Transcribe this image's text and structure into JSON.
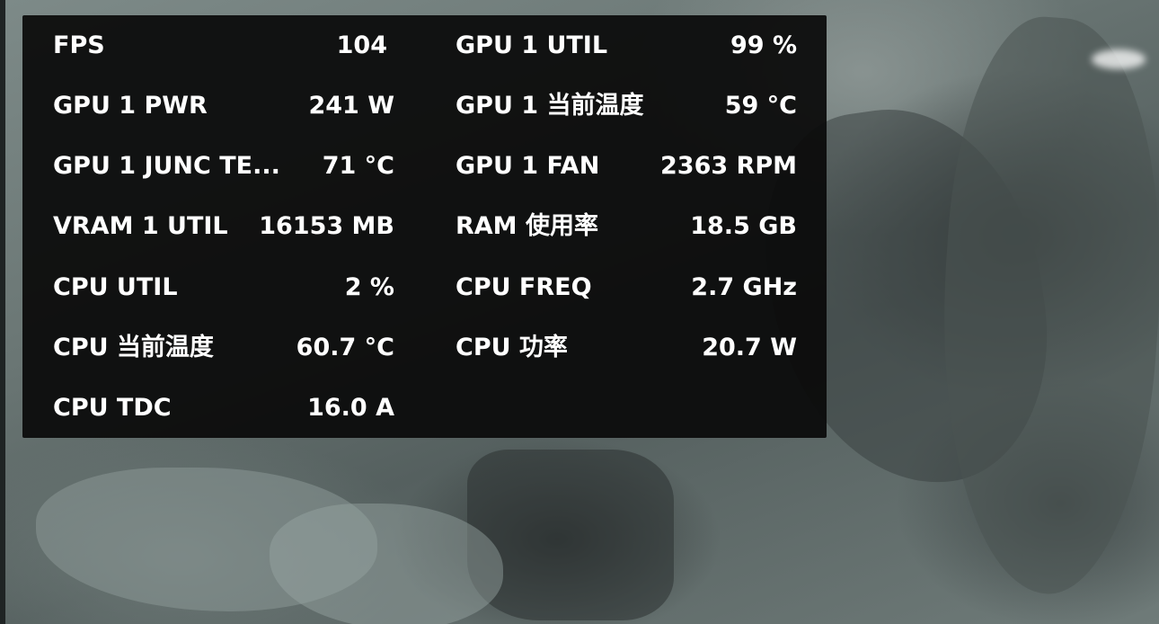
{
  "overlay": {
    "left_column": [
      {
        "label": "FPS",
        "value": "104"
      },
      {
        "label": "GPU 1 PWR",
        "value": "241 W"
      },
      {
        "label": "GPU 1 JUNC TE...",
        "value": "71 °C"
      },
      {
        "label": "VRAM 1 UTIL",
        "value": "16153 MB"
      },
      {
        "label": "CPU UTIL",
        "value": "2 %"
      },
      {
        "label": "CPU 当前温度",
        "value": "60.7 °C"
      },
      {
        "label": "CPU TDC",
        "value": "16.0 A"
      }
    ],
    "right_column": [
      {
        "label": "GPU 1 UTIL",
        "value": "99 %"
      },
      {
        "label": "GPU 1 当前温度",
        "value": "59 °C"
      },
      {
        "label": "GPU 1 FAN",
        "value": "2363 RPM"
      },
      {
        "label": "RAM 使用率",
        "value": "18.5 GB"
      },
      {
        "label": "CPU FREQ",
        "value": "2.7 GHz"
      },
      {
        "label": "CPU 功率",
        "value": "20.7 W"
      }
    ]
  },
  "colors": {
    "overlay_background": "#0a0a0a",
    "text": "#ffffff"
  }
}
